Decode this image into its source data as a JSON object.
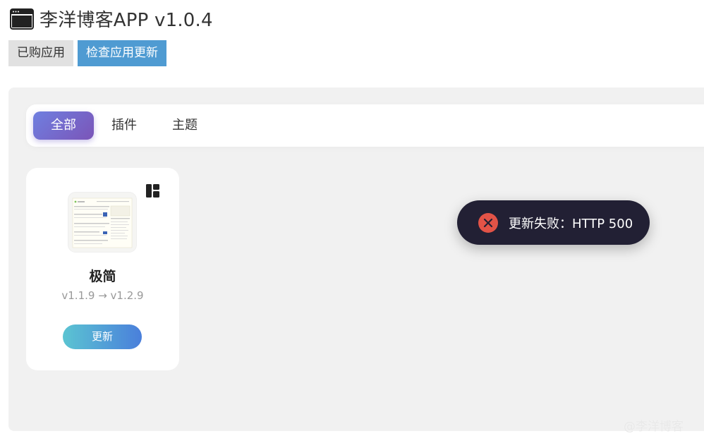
{
  "header": {
    "title": "李洋博客APP v1.0.4",
    "icon": "app-window-icon"
  },
  "actions": {
    "purchased_label": "已购应用",
    "check_update_label": "检查应用更新"
  },
  "tabs": [
    {
      "label": "全部",
      "active": true
    },
    {
      "label": "插件",
      "active": false
    },
    {
      "label": "主题",
      "active": false
    }
  ],
  "card": {
    "name": "极简",
    "version": "v1.1.9 → v1.2.9",
    "update_label": "更新",
    "corner_icon": "layout-grid-icon"
  },
  "toast": {
    "message": "更新失败：HTTP 500",
    "icon": "error-x-icon",
    "color": "#e25347"
  },
  "watermark": "@李洋博客",
  "colors": {
    "accent_blue": "#4f9bd2",
    "tab_active": "#7166cc",
    "toast_bg": "#222034"
  }
}
